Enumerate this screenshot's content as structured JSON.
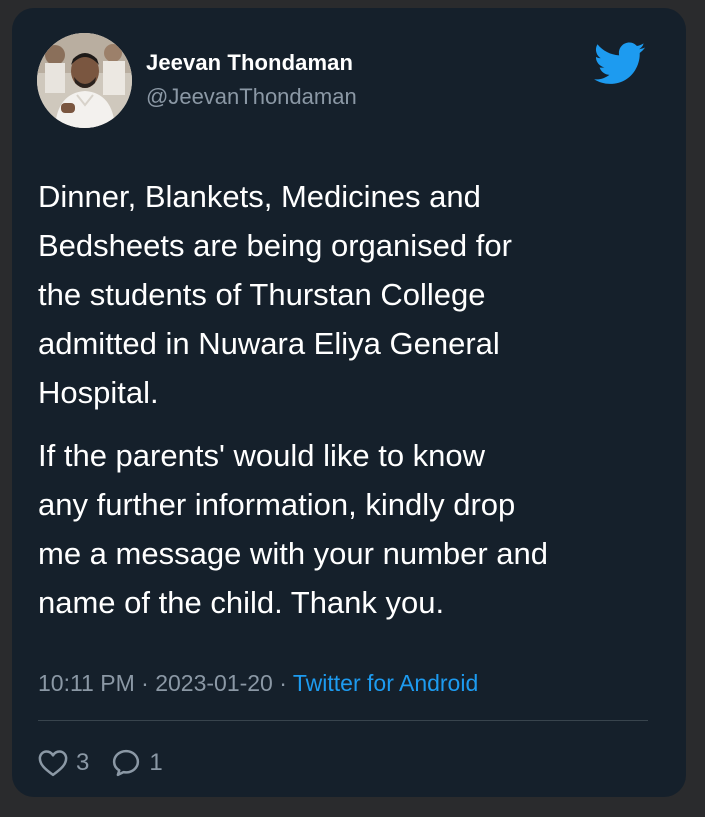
{
  "user": {
    "name": "Jeevan Thondaman",
    "handle": "@JeevanThondaman"
  },
  "tweet": {
    "paragraphs": [
      "Dinner, Blankets, Medicines and\nBedsheets are being organised for\nthe students of Thurstan College\nadmitted in Nuwara Eliya General\nHospital.",
      "If the parents' would like to know\nany further information, kindly drop\nme a message with your number and\nname of the child. Thank you."
    ]
  },
  "meta": {
    "time": "10:11 PM",
    "separator": " · ",
    "date": "2023-01-20",
    "source": "Twitter for Android"
  },
  "actions": {
    "likes": "3",
    "replies": "1"
  },
  "icons": {
    "brand": "twitter-bird-icon",
    "like": "heart-icon",
    "reply": "speech-bubble-icon"
  },
  "colors": {
    "background": "#15202b",
    "text": "#ffffff",
    "muted": "#8b98a5",
    "accent": "#1d9bf0"
  }
}
